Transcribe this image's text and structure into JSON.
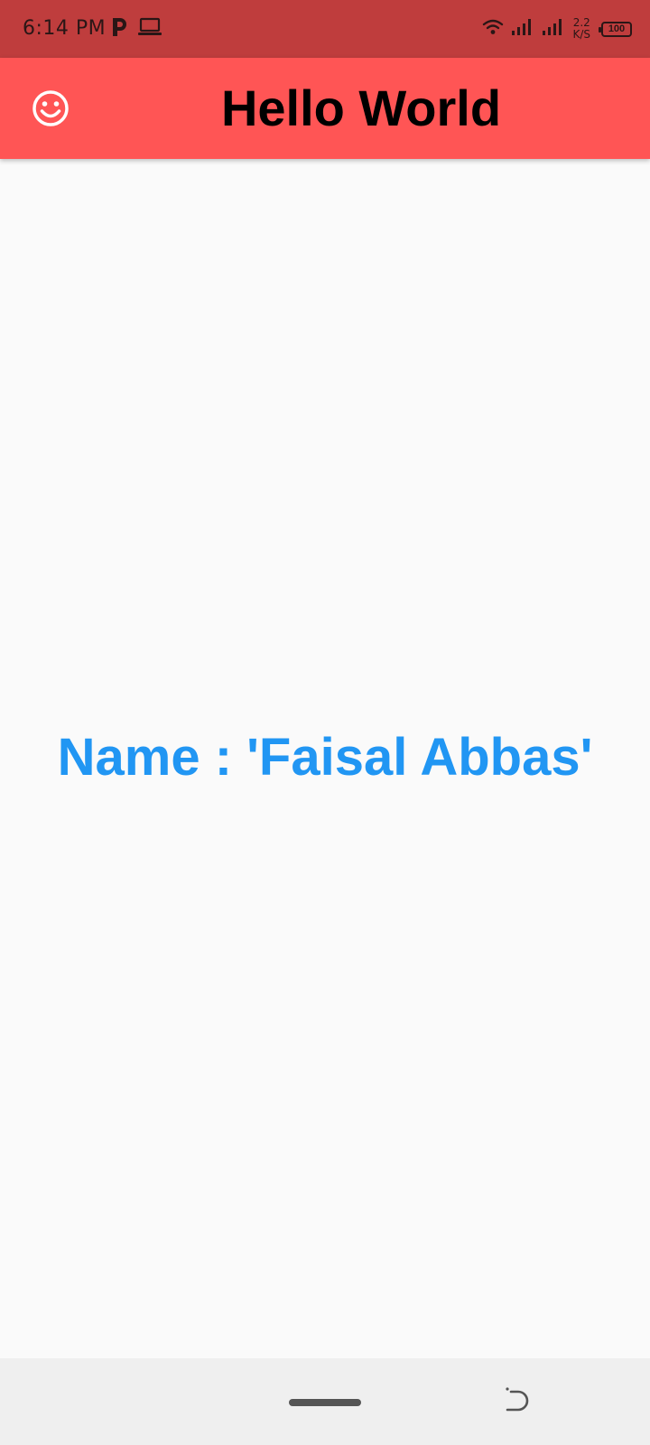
{
  "status_bar": {
    "time": "6:14 PM",
    "net_speed_value": "2.2",
    "net_speed_unit": "K/S",
    "battery_level": "100",
    "icons": [
      "p-app-icon",
      "laptop-icon",
      "wifi-icon",
      "signal-icon",
      "signal-icon",
      "battery-icon"
    ]
  },
  "app_bar": {
    "title": "Hello World",
    "leading_icon": "smiley-face-icon",
    "background_color": "#ff5555"
  },
  "main": {
    "name_text": "Name : 'Faisal Abbas'",
    "text_color": "#2196f3",
    "background_color": "#fafafa"
  },
  "nav_bar": {
    "icons": [
      "home-pill",
      "back-gesture-icon"
    ]
  }
}
